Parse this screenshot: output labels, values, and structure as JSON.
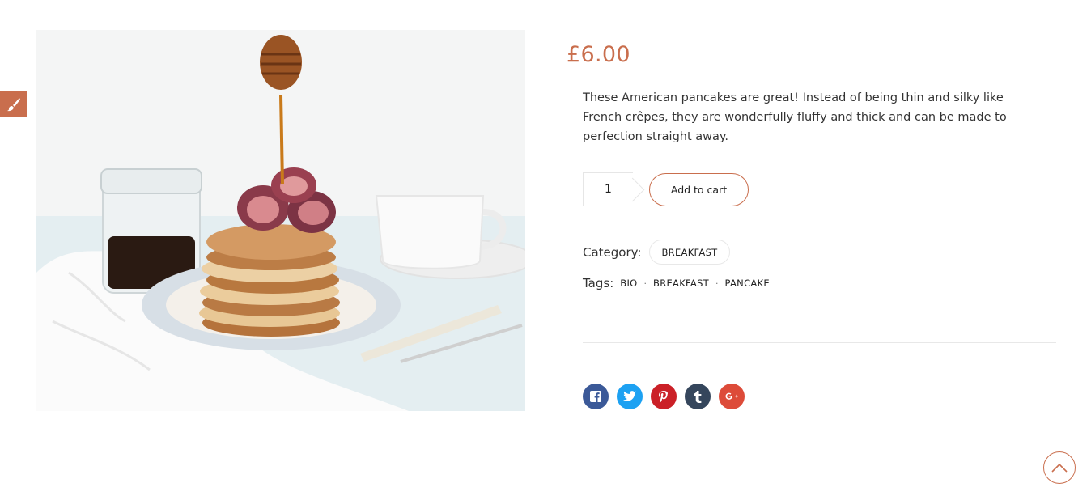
{
  "product": {
    "price": "£6.00",
    "description": "These American pancakes are great! Instead of being thin and silky like French crêpes, they are wonderfully fluffy and thick and can be made to perfection straight away.",
    "quantity": "1",
    "add_to_cart_label": "Add to cart",
    "category_label": "Category:",
    "category": "BREAKFAST",
    "tags_label": "Tags:",
    "tags": [
      "BIO",
      "BREAKFAST",
      "PANCAKE"
    ]
  },
  "share": [
    {
      "icon": "facebook-icon",
      "glyph": "f",
      "color": "#3b5998"
    },
    {
      "icon": "twitter-icon",
      "glyph": "t",
      "color": "#1da1f2"
    },
    {
      "icon": "pinterest-icon",
      "glyph": "P",
      "color": "#cb2027"
    },
    {
      "icon": "tumblr-icon",
      "glyph": "t",
      "color": "#35465c"
    },
    {
      "icon": "google-plus-icon",
      "glyph": "G+",
      "color": "#dd4b39"
    }
  ],
  "colors": {
    "accent": "#c96e4d"
  }
}
